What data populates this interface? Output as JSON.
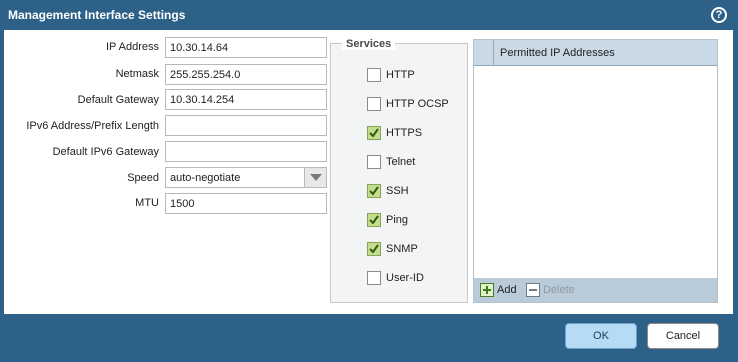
{
  "dialog": {
    "title": "Management Interface Settings",
    "help_label": "?"
  },
  "form": {
    "ip_address": {
      "label": "IP Address",
      "value": "10.30.14.64"
    },
    "netmask": {
      "label": "Netmask",
      "value": "255.255.254.0"
    },
    "default_gateway": {
      "label": "Default Gateway",
      "value": "10.30.14.254"
    },
    "ipv6_address": {
      "label": "IPv6 Address/Prefix Length",
      "value": ""
    },
    "ipv6_gateway": {
      "label": "Default IPv6 Gateway",
      "value": ""
    },
    "speed": {
      "label": "Speed",
      "value": "auto-negotiate"
    },
    "mtu": {
      "label": "MTU",
      "value": "1500"
    }
  },
  "services": {
    "legend": "Services",
    "items": [
      {
        "label": "HTTP",
        "checked": false
      },
      {
        "label": "HTTP OCSP",
        "checked": false
      },
      {
        "label": "HTTPS",
        "checked": true
      },
      {
        "label": "Telnet",
        "checked": false
      },
      {
        "label": "SSH",
        "checked": true
      },
      {
        "label": "Ping",
        "checked": true
      },
      {
        "label": "SNMP",
        "checked": true
      },
      {
        "label": "User-ID",
        "checked": false
      }
    ]
  },
  "permitted_ips": {
    "header": "Permitted IP Addresses",
    "add_label": "Add",
    "delete_label": "Delete"
  },
  "buttons": {
    "ok": "OK",
    "cancel": "Cancel"
  },
  "colors": {
    "titlebar": "#2d6188",
    "checked_fill": "#c4dd8c",
    "panel_header": "#c9d9e6",
    "ok_button": "#b5dbf5"
  }
}
